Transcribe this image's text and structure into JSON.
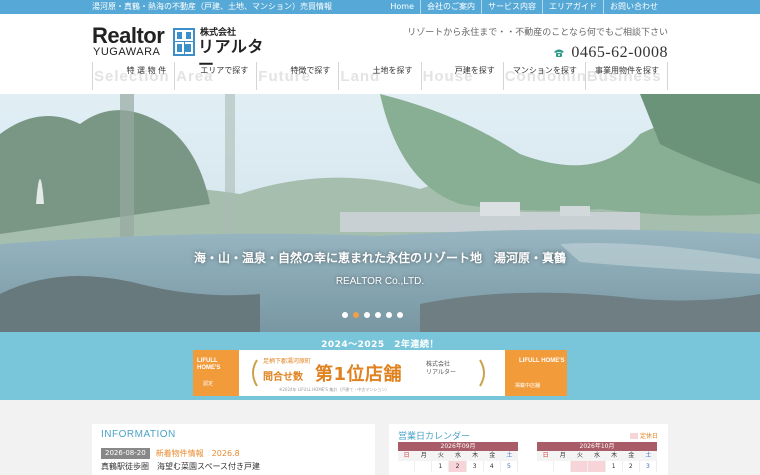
{
  "topbar": {
    "tagline": "湯河原・真鶴・熱海の不動産（戸建、土地、マンション）売買情報",
    "links": [
      "Home",
      "会社のご案内",
      "サービス内容",
      "エリアガイド",
      "お問い合わせ"
    ]
  },
  "logo": {
    "en_line1": "Realtor",
    "en_line2": "YUGAWARA",
    "jp_line1": "株式会社",
    "jp_line2": "リアルター"
  },
  "header": {
    "message": "リゾートから永住まで・・不動産のことなら何でもご相談下さい",
    "tel": "0465-62-0008",
    "colors": {
      "accent": "#56a9d6",
      "tel_icon": "#2f9a8a"
    }
  },
  "gnav": [
    {
      "ghost": "Selection",
      "label": "特 選 物 件"
    },
    {
      "ghost": "Area",
      "label": "エリアで探す"
    },
    {
      "ghost": "Future",
      "label": "特徴で探す"
    },
    {
      "ghost": "Land",
      "label": "土地を探す"
    },
    {
      "ghost": "House",
      "label": "戸建を探す"
    },
    {
      "ghost": "Condominium",
      "label": "マンションを探す"
    },
    {
      "ghost": "Business",
      "label": "事業用物件を探す"
    }
  ],
  "hero": {
    "caption": "海・山・温泉・自然の幸に恵まれた永住のリゾート地　湯河原・真鶴",
    "sub": "REALTOR Co.,LTD.",
    "slide_count": 6,
    "active_slide": 1
  },
  "banner": {
    "title": "2024〜2025　2年連続！",
    "left_badge": "LIFULL HOME'S",
    "left_badge_sub": "認定",
    "line_small": "足柄下郡湯河原町",
    "line_mid": "問合せ数",
    "big": "第1位店舗",
    "company1": "株式会社",
    "company2": "リアルター",
    "right_badge": "LIFULL HOME'S",
    "right_badge_sub": "掲載中店舗",
    "footnote": "※2024年 LIFULL HOME'S 集計（戸建て・中古マンション）"
  },
  "info": {
    "heading": "INFORMATION",
    "date": "2026-08-20",
    "category": "新着物件情報　2026.8",
    "title": "真鶴駅徒歩圏　海望む菜園スペース付き戸建"
  },
  "calendar": {
    "heading": "営業日カレンダー",
    "legend": "定休日",
    "weekdays": [
      "日",
      "月",
      "火",
      "水",
      "木",
      "金",
      "土"
    ],
    "months": [
      {
        "title": "2026年09月",
        "days": [
          "",
          "",
          "1",
          "2",
          "3",
          "4",
          "5"
        ],
        "holidays": [
          3
        ]
      },
      {
        "title": "2026年10月",
        "days": [
          "",
          "",
          "",
          "",
          "1",
          "2",
          "3"
        ],
        "holidays": [
          2,
          3
        ]
      }
    ]
  }
}
